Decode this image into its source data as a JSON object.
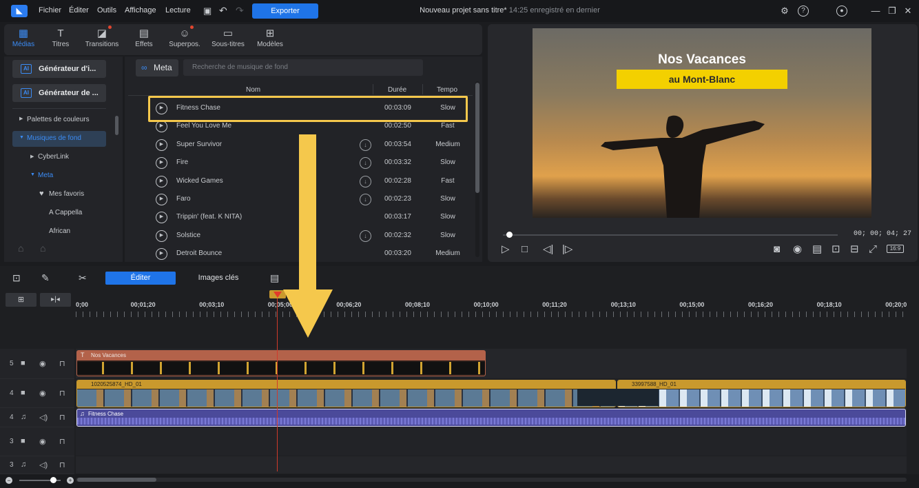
{
  "menu": {
    "file": "Fichier",
    "edit": "Éditer",
    "tools": "Outils",
    "view": "Affichage",
    "play": "Lecture"
  },
  "export_label": "Exporter",
  "project": {
    "title": "Nouveau projet sans titre*",
    "saved": "14:25 enregistré en dernier"
  },
  "tabs": [
    {
      "label": "Médias",
      "icon": "media-icon"
    },
    {
      "label": "Titres",
      "icon": "title-icon"
    },
    {
      "label": "Transitions",
      "icon": "transition-icon"
    },
    {
      "label": "Effets",
      "icon": "effects-icon"
    },
    {
      "label": "Superpos.",
      "icon": "overlay-icon"
    },
    {
      "label": "Sous-titres",
      "icon": "subtitles-icon"
    },
    {
      "label": "Modèles",
      "icon": "templates-icon"
    }
  ],
  "sidebar": {
    "gen1": "Générateur d'i...",
    "gen2": "Générateur de ...",
    "items": [
      "Palettes de couleurs",
      "Musiques de fond",
      "CyberLink",
      "Meta",
      "Mes favoris",
      "A Cappella",
      "African"
    ]
  },
  "library": {
    "source_label": "Meta",
    "search_placeholder": "Recherche de musique de fond",
    "columns": {
      "name": "Nom",
      "duration": "Durée",
      "tempo": "Tempo"
    },
    "rows": [
      {
        "name": "Fitness Chase",
        "duration": "00:03:09",
        "tempo": "Slow",
        "download": false
      },
      {
        "name": "Feel You Love Me",
        "duration": "00:02:50",
        "tempo": "Fast",
        "download": false
      },
      {
        "name": "Super Survivor",
        "duration": "00:03:54",
        "tempo": "Medium",
        "download": true
      },
      {
        "name": "Fire",
        "duration": "00:03:32",
        "tempo": "Slow",
        "download": true
      },
      {
        "name": "Wicked Games",
        "duration": "00:02:28",
        "tempo": "Fast",
        "download": true
      },
      {
        "name": "Faro",
        "duration": "00:02:23",
        "tempo": "Slow",
        "download": true
      },
      {
        "name": "Trippin' (feat. K NITA)",
        "duration": "00:03:17",
        "tempo": "Slow",
        "download": false
      },
      {
        "name": "Solstice",
        "duration": "00:02:32",
        "tempo": "Slow",
        "download": true
      },
      {
        "name": "Detroit Bounce",
        "duration": "00:03:20",
        "tempo": "Medium",
        "download": false
      }
    ]
  },
  "preview": {
    "title": "Nos Vacances",
    "subtitle": "au Mont-Blanc",
    "timecode": "00; 00; 04; 27",
    "aspect": "16:9"
  },
  "timeline": {
    "edit_label": "Éditer",
    "keyframes_label": "Images clés",
    "ruler": [
      "0;00",
      "00;01;20",
      "00;03;10",
      "00;05;00",
      "00;06;20",
      "00;08;10",
      "00;10;00",
      "00;11;20",
      "00;13;10",
      "00;15;00",
      "00;16;20",
      "00;18;10",
      "00;20;0"
    ],
    "tracks": [
      {
        "num": "5",
        "type": "video"
      },
      {
        "num": "4",
        "type": "video"
      },
      {
        "num": "4",
        "type": "audio"
      },
      {
        "num": "3",
        "type": "video"
      },
      {
        "num": "3",
        "type": "audio"
      }
    ],
    "clips": {
      "title": "Nos Vacances",
      "video1": "1020525874_HD_01",
      "video2": "33997588_HD_01",
      "audio": "Fitness Chase"
    }
  }
}
